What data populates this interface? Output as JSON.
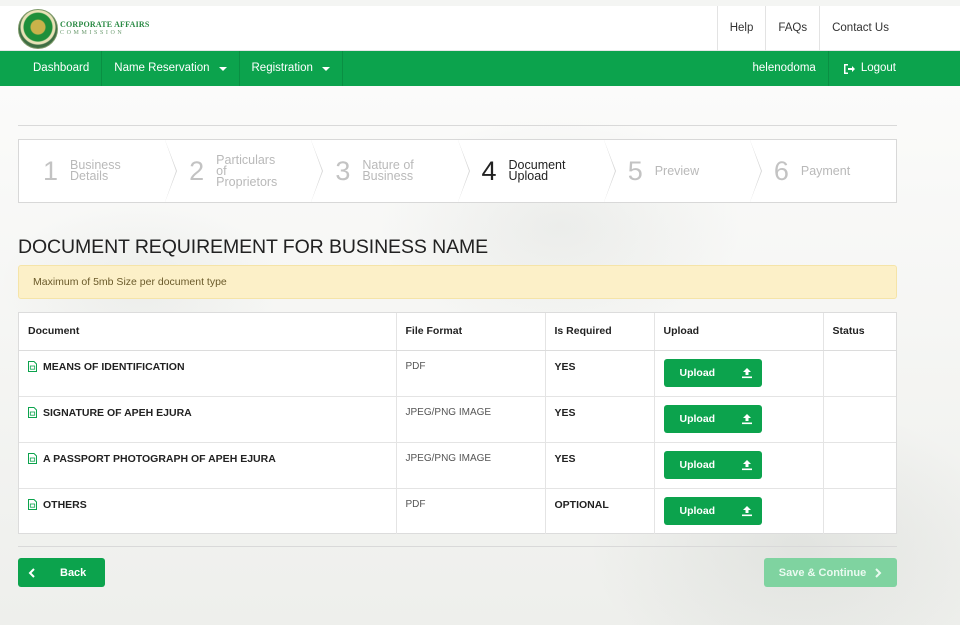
{
  "header": {
    "logo": {
      "line1": "CORPORATE AFFAIRS",
      "line2": "COMMISSION"
    },
    "links": [
      "Help",
      "FAQs",
      "Contact Us"
    ]
  },
  "nav": {
    "dashboard": "Dashboard",
    "name_reservation": "Name Reservation",
    "registration": "Registration",
    "username": "helenodoma",
    "logout": "Logout"
  },
  "wizard": {
    "active_step": 4,
    "steps": [
      {
        "num": "1",
        "label": "Business\nDetails"
      },
      {
        "num": "2",
        "label": "Particulars\nof\nProprietors"
      },
      {
        "num": "3",
        "label": "Nature of\nBusiness"
      },
      {
        "num": "4",
        "label": "Document\nUpload"
      },
      {
        "num": "5",
        "label": "Preview"
      },
      {
        "num": "6",
        "label": "Payment"
      }
    ]
  },
  "page": {
    "title": "DOCUMENT REQUIREMENT FOR BUSINESS NAME",
    "alert": "Maximum of 5mb Size per document type"
  },
  "table": {
    "headers": [
      "Document",
      "File Format",
      "Is Required",
      "Upload",
      "Status"
    ],
    "upload_label": "Upload",
    "rows": [
      {
        "document": "MEANS OF IDENTIFICATION",
        "format": "PDF",
        "required": "YES",
        "status": ""
      },
      {
        "document": "SIGNATURE OF APEH EJURA",
        "format": "JPEG/PNG IMAGE",
        "required": "YES",
        "status": ""
      },
      {
        "document": "A PASSPORT PHOTOGRAPH OF APEH EJURA",
        "format": "JPEG/PNG IMAGE",
        "required": "YES",
        "status": ""
      },
      {
        "document": "OTHERS",
        "format": "PDF",
        "required": "OPTIONAL",
        "status": ""
      }
    ]
  },
  "footer": {
    "back": "Back",
    "save": "Save & Continue"
  },
  "colors": {
    "brand_green": "#0ca34d",
    "disabled_green": "#7fd3a0",
    "alert_bg": "#fcf0c8"
  },
  "icons": {
    "logout": "sign-out-icon",
    "document": "file-pdf-icon",
    "upload": "upload-icon",
    "back": "chevron-left-icon",
    "save": "chevron-right-icon"
  }
}
